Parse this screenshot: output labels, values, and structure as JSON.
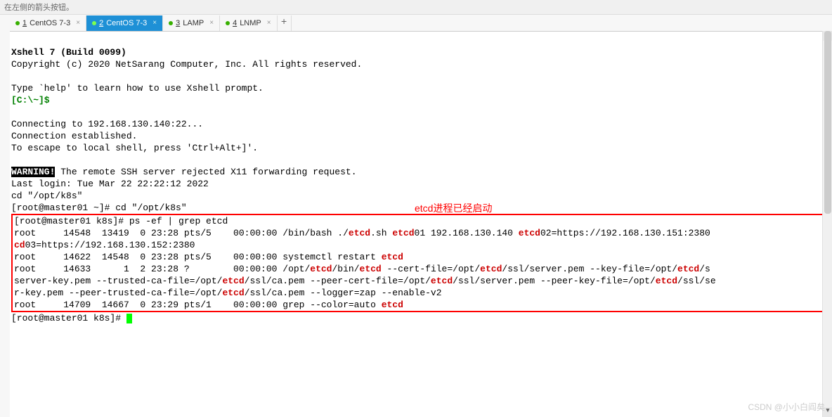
{
  "hint": "在左侧的箭头按钮。",
  "tabs": [
    {
      "num": "1",
      "label": "CentOS 7-3",
      "active": false
    },
    {
      "num": "2",
      "label": "CentOS 7-3",
      "active": true
    },
    {
      "num": "3",
      "label": "LAMP",
      "active": false
    },
    {
      "num": "4",
      "label": "LNMP",
      "active": false
    }
  ],
  "tab_add": "+",
  "term": {
    "title": "Xshell 7 (Build 0099)",
    "copyright": "Copyright (c) 2020 NetSarang Computer, Inc. All rights reserved.",
    "blank": "",
    "help": "Type `help' to learn how to use Xshell prompt.",
    "prompt_local": "[C:\\~]$",
    "connecting": "Connecting to 192.168.130.140:22...",
    "established": "Connection established.",
    "escape": "To escape to local shell, press 'Ctrl+Alt+]'.",
    "warning_tag": "WARNING!",
    "warning_rest": " The remote SSH server rejected X11 forwarding request.",
    "last_login": "Last login: Tue Mar 22 22:22:12 2022",
    "cd1": "cd \"/opt/k8s\"",
    "prompt_home": "[root@master01 ~]# ",
    "cmd_cd": "cd \"/opt/k8s\"",
    "box": {
      "prompt": "[root@master01 k8s]# ",
      "cmd1": "ps -ef | grep etcd",
      "l1a": "root     14548  13419  0 23:28 pts/5    00:00:00 /bin/bash ./",
      "l1b": ".sh ",
      "l1c": "01 192.168.130.140 ",
      "l1d": "02=https://192.168.130.151:2380",
      "l2a": "cd",
      "l2b": "03=https://192.168.130.152:2380",
      "l3a": "root     14622  14548  0 23:28 pts/5    00:00:00 systemctl restart ",
      "l4a": "root     14633      1  2 23:28 ?        00:00:00 /opt/",
      "l4b": "/bin/",
      "l4c": " --cert-file=/opt/",
      "l4d": "/ssl/server.pem --key-file=/opt/",
      "l4e": "/s",
      "l5a": "server-key.pem --trusted-ca-file=/opt/",
      "l5b": "/ssl/ca.pem --peer-cert-file=/opt/",
      "l5c": "/ssl/server.pem --peer-key-file=/opt/",
      "l5d": "/ssl/se",
      "l6a": "r-key.pem --peer-trusted-ca-file=/opt/",
      "l6b": "/ssl/ca.pem --logger=zap --enable-v2",
      "l7a": "root     14709  14667  0 23:29 pts/1    00:00:00 grep --color=auto ",
      "hl_etcd": "etcd"
    },
    "prompt_after": "[root@master01 k8s]# "
  },
  "annotation": "etcd进程已经启动",
  "watermark": "CSDN @小小白阎矣"
}
